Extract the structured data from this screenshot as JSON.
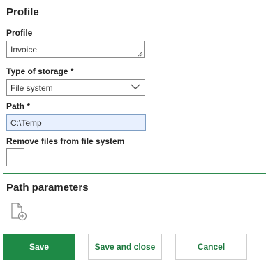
{
  "profile_section": {
    "title": "Profile",
    "profile_field": {
      "label": "Profile",
      "value": "Invoice"
    },
    "storage_field": {
      "label": "Type of storage *",
      "value": "File system"
    },
    "path_field": {
      "label": "Path *",
      "value": "C:\\Temp"
    },
    "remove_files_field": {
      "label": "Remove files from file system",
      "checked": false
    }
  },
  "path_parameters_section": {
    "title": "Path parameters",
    "add_icon": "add-document-icon"
  },
  "actions": {
    "save_label": "Save",
    "save_close_label": "Save and close",
    "cancel_label": "Cancel"
  },
  "colors": {
    "accent": "#1e8a46",
    "divider": "#2e8b4e",
    "autofill_bg": "#e8f0fe"
  }
}
